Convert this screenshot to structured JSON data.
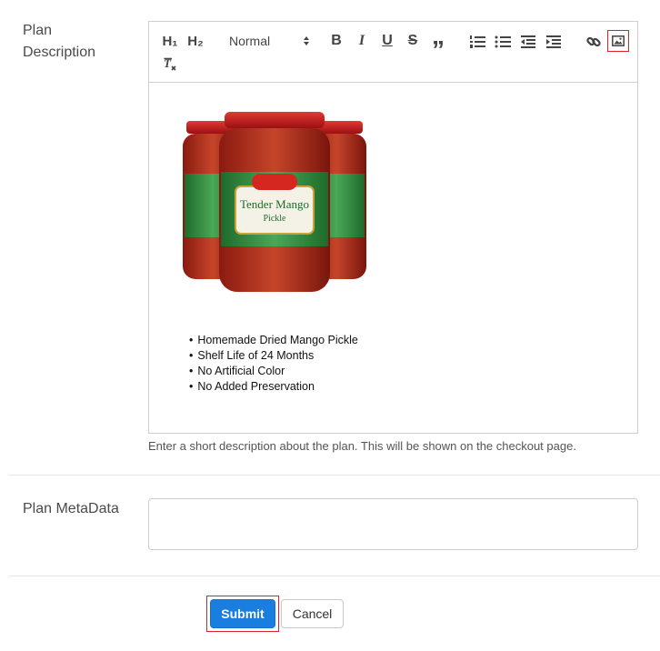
{
  "labels": {
    "plan_description": "Plan\nDescription",
    "plan_metadata": "Plan MetaData"
  },
  "toolbar": {
    "h1": "H₁",
    "h2": "H₂",
    "format_select": "Normal",
    "bold": "B",
    "italic": "I",
    "underline": "U",
    "strike": "S",
    "quote": "”"
  },
  "editor_content": {
    "bullets": [
      "Homemade Dried Mango Pickle",
      "Shelf Life of 24 Months",
      "No Artificial Color",
      "No Added Preservation"
    ],
    "product_label": "Tender Mango",
    "product_sub": "Pickle"
  },
  "help_text": "Enter a short description about the plan. This will be shown on the checkout page.",
  "buttons": {
    "submit": "Submit",
    "cancel": "Cancel"
  },
  "colors": {
    "primary": "#1a7de0",
    "highlight": "#d9232d",
    "jar_lid": "#c3161c",
    "jar_label": "#2f8a3a"
  }
}
